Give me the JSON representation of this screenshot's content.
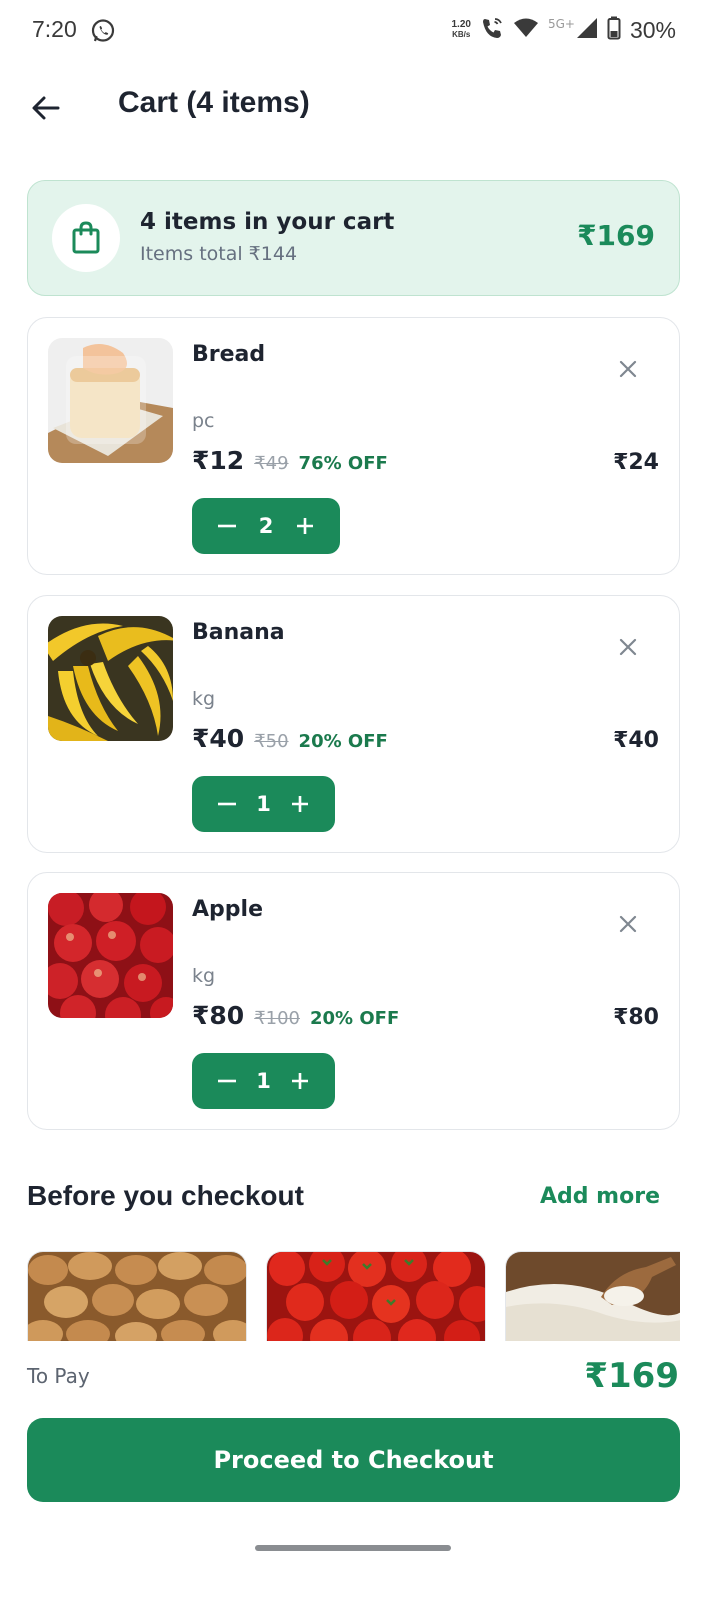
{
  "status_bar": {
    "time": "7:20",
    "net_speed_value": "1.20",
    "net_speed_unit": "KB/s",
    "network_type": "5G+",
    "battery": "30%"
  },
  "header": {
    "title": "Cart (4 items)"
  },
  "summary": {
    "title": "4 items in your cart",
    "subtitle": "Items total ₹144",
    "total": "₹169"
  },
  "cart_items": [
    {
      "name": "Bread",
      "unit": "pc",
      "price": "₹12",
      "mrp": "₹49",
      "discount": "76% OFF",
      "line_total": "₹24",
      "quantity": "2",
      "image": "bread-image"
    },
    {
      "name": "Banana",
      "unit": "kg",
      "price": "₹40",
      "mrp": "₹50",
      "discount": "20% OFF",
      "line_total": "₹40",
      "quantity": "1",
      "image": "banana-image"
    },
    {
      "name": "Apple",
      "unit": "kg",
      "price": "₹80",
      "mrp": "₹100",
      "discount": "20% OFF",
      "line_total": "₹80",
      "quantity": "1",
      "image": "apple-image"
    }
  ],
  "suggestions": {
    "title": "Before you checkout",
    "action": "Add more",
    "items": [
      "potato-image",
      "tomato-image",
      "rice-image"
    ]
  },
  "footer": {
    "to_pay_label": "To Pay",
    "to_pay_amount": "₹169",
    "checkout_label": "Proceed to Checkout"
  },
  "colors": {
    "accent": "#1b8a5a",
    "summary_bg": "#e3f4ec",
    "text": "#1e2430"
  }
}
